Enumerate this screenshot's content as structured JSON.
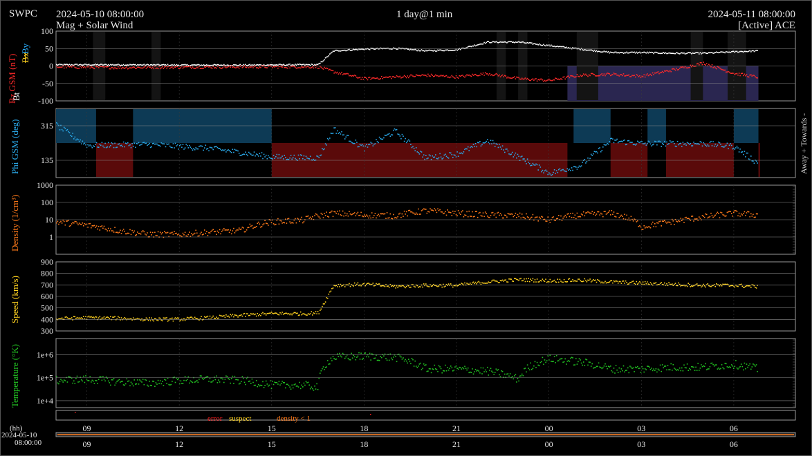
{
  "header": {
    "brand": "SWPC",
    "start_time": "2024-05-10 08:00:00",
    "subtitle": "Mag + Solar Wind",
    "cadence": "1 day@1 min",
    "end_time": "2024-05-11 08:00:00",
    "source": "[Active] ACE"
  },
  "colors": {
    "bt": "#ffffff",
    "bz": "#ff2a2a",
    "bx": "#ffd21f",
    "by": "#2ab0ff",
    "phi": "#2aa8e8",
    "density": "#ff7a1a",
    "speed": "#ffd21f",
    "temperature": "#22c322",
    "error": "#ff2020",
    "suspect": "#ffd21f",
    "density_lt1": "#ff7a1a",
    "away_fill": "#0d3a55",
    "towards_fill": "#5a0a0a",
    "neg_bz_fill": "#2a2650",
    "grid": "#8c8c8c",
    "panel_border": "#9a9a9a"
  },
  "panels": {
    "mag": {
      "label_bz": "Bz GSM (nT)",
      "label_bx": "Bx",
      "label_by": "By",
      "label_bt": "Bt",
      "ticks": [
        "100",
        "50",
        "0",
        "-50",
        "-100"
      ]
    },
    "phi": {
      "label": "Phi GSM (deg)",
      "ticks": [
        "315",
        "135"
      ],
      "right_label": "Away + Towards -"
    },
    "density": {
      "label": "Density (1/cm³)",
      "ticks": [
        "1000",
        "100",
        "10",
        "1"
      ]
    },
    "speed": {
      "label": "Speed (km/s)",
      "ticks": [
        "900",
        "800",
        "700",
        "600",
        "500",
        "400",
        "300"
      ]
    },
    "temperature": {
      "label": "Temperature (°K)",
      "ticks": [
        "1e+6",
        "1e+5",
        "1e+4"
      ]
    }
  },
  "legend": {
    "error": "error",
    "suspect": "suspect",
    "density_lt1": "density < 1"
  },
  "time_axis": {
    "hh_label": "(hh)",
    "start_date": "2024-05-10",
    "start_clock": "08:00:00",
    "tick_labels": [
      "09",
      "12",
      "15",
      "18",
      "21",
      "00",
      "03",
      "06"
    ]
  },
  "chart_data": [
    {
      "type": "scatter",
      "panel": "magnetic field",
      "x": [
        "2024-05-10 08:00",
        "2024-05-10 10:00",
        "2024-05-10 12:00",
        "2024-05-10 14:00",
        "2024-05-10 16:00",
        "2024-05-10 16:30",
        "2024-05-10 17:00",
        "2024-05-10 18:00",
        "2024-05-10 19:00",
        "2024-05-10 20:00",
        "2024-05-10 21:00",
        "2024-05-10 22:00",
        "2024-05-10 23:00",
        "2024-05-11 00:00",
        "2024-05-11 01:00",
        "2024-05-11 02:00",
        "2024-05-11 03:00",
        "2024-05-11 04:00",
        "2024-05-11 05:00",
        "2024-05-11 06:00",
        "2024-05-11 06:45"
      ],
      "series": [
        {
          "name": "Bt",
          "values": [
            5,
            5,
            4,
            4,
            5,
            5,
            45,
            50,
            52,
            45,
            48,
            70,
            70,
            60,
            50,
            40,
            40,
            38,
            38,
            42,
            45
          ]
        },
        {
          "name": "Bz GSM",
          "values": [
            -1,
            -3,
            -2,
            -1,
            -1,
            -1,
            -15,
            -35,
            -30,
            -25,
            -30,
            -20,
            -35,
            -40,
            -25,
            -22,
            -28,
            -10,
            10,
            -20,
            -30
          ]
        }
      ],
      "ylim": [
        -100,
        100
      ]
    },
    {
      "type": "scatter",
      "panel": "Phi GSM",
      "x": [
        "2024-05-10 08:00",
        "2024-05-10 09:00",
        "2024-05-10 11:00",
        "2024-05-10 13:00",
        "2024-05-10 15:00",
        "2024-05-10 16:30",
        "2024-05-10 17:00",
        "2024-05-10 18:00",
        "2024-05-10 19:00",
        "2024-05-10 20:00",
        "2024-05-10 21:00",
        "2024-05-10 22:00",
        "2024-05-11 00:00",
        "2024-05-11 01:00",
        "2024-05-11 02:00",
        "2024-05-11 03:00",
        "2024-05-11 04:00",
        "2024-05-11 05:00",
        "2024-05-11 06:00",
        "2024-05-11 06:45"
      ],
      "values": [
        320,
        215,
        220,
        200,
        155,
        150,
        300,
        200,
        290,
        150,
        170,
        240,
        70,
        110,
        240,
        225,
        225,
        225,
        210,
        125
      ],
      "ylim": [
        45,
        405
      ]
    },
    {
      "type": "scatter",
      "panel": "density",
      "yscale": "log",
      "x": [
        "2024-05-10 08:00",
        "2024-05-10 09:00",
        "2024-05-10 10:00",
        "2024-05-10 11:00",
        "2024-05-10 12:00",
        "2024-05-10 13:00",
        "2024-05-10 14:00",
        "2024-05-10 15:00",
        "2024-05-10 16:00",
        "2024-05-10 17:00",
        "2024-05-10 18:00",
        "2024-05-10 19:00",
        "2024-05-10 20:00",
        "2024-05-10 21:00",
        "2024-05-10 22:00",
        "2024-05-10 23:00",
        "2024-05-11 00:00",
        "2024-05-11 01:00",
        "2024-05-11 02:00",
        "2024-05-11 03:00",
        "2024-05-11 04:00",
        "2024-05-11 05:00",
        "2024-05-11 06:00",
        "2024-05-11 06:45"
      ],
      "values": [
        8,
        5,
        2.5,
        1.5,
        1.5,
        2,
        2.5,
        8,
        10,
        25,
        20,
        18,
        35,
        25,
        20,
        18,
        10,
        20,
        25,
        4,
        8,
        15,
        25,
        20
      ],
      "ylim": [
        0.1,
        1000
      ]
    },
    {
      "type": "scatter",
      "panel": "speed",
      "x": [
        "2024-05-10 08:00",
        "2024-05-10 09:00",
        "2024-05-10 10:00",
        "2024-05-10 11:00",
        "2024-05-10 12:00",
        "2024-05-10 13:00",
        "2024-05-10 14:00",
        "2024-05-10 15:00",
        "2024-05-10 16:00",
        "2024-05-10 16:30",
        "2024-05-10 17:00",
        "2024-05-10 18:00",
        "2024-05-10 19:00",
        "2024-05-10 20:00",
        "2024-05-10 21:00",
        "2024-05-10 22:00",
        "2024-05-10 23:00",
        "2024-05-11 00:00",
        "2024-05-11 01:00",
        "2024-05-11 02:00",
        "2024-05-11 03:00",
        "2024-05-11 04:00",
        "2024-05-11 05:00",
        "2024-05-11 06:00",
        "2024-05-11 06:45"
      ],
      "values": [
        410,
        420,
        415,
        405,
        405,
        420,
        440,
        455,
        455,
        460,
        700,
        710,
        690,
        700,
        700,
        730,
        750,
        740,
        745,
        730,
        720,
        710,
        700,
        700,
        690
      ],
      "ylim": [
        300,
        900
      ]
    },
    {
      "type": "scatter",
      "panel": "temperature",
      "yscale": "log",
      "x": [
        "2024-05-10 08:00",
        "2024-05-10 09:00",
        "2024-05-10 10:00",
        "2024-05-10 11:00",
        "2024-05-10 12:00",
        "2024-05-10 13:00",
        "2024-05-10 14:00",
        "2024-05-10 15:00",
        "2024-05-10 16:00",
        "2024-05-10 16:30",
        "2024-05-10 17:00",
        "2024-05-10 18:00",
        "2024-05-10 19:00",
        "2024-05-10 20:00",
        "2024-05-10 21:00",
        "2024-05-10 22:00",
        "2024-05-10 23:00",
        "2024-05-11 00:00",
        "2024-05-11 01:00",
        "2024-05-11 02:00",
        "2024-05-11 03:00",
        "2024-05-11 04:00",
        "2024-05-11 05:00",
        "2024-05-11 06:00",
        "2024-05-11 06:45"
      ],
      "values": [
        80000,
        90000,
        70000,
        60000,
        80000,
        90000,
        80000,
        50000,
        50000,
        40000,
        800000,
        900000,
        800000,
        250000,
        250000,
        200000,
        90000,
        700000,
        500000,
        250000,
        250000,
        300000,
        300000,
        400000,
        250000
      ],
      "ylim": [
        5000,
        5000000
      ]
    }
  ]
}
